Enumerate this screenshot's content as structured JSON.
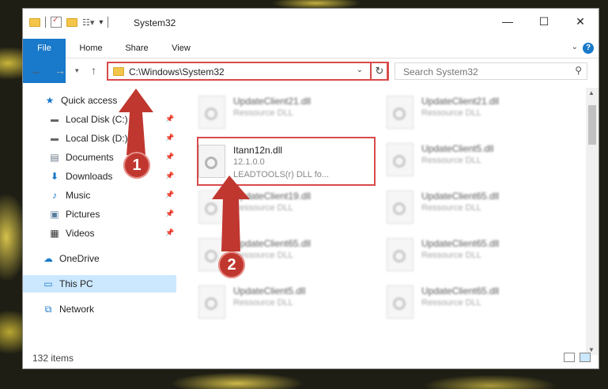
{
  "window": {
    "title": "System32",
    "controls": {
      "minimize": "—",
      "maximize": "☐",
      "close": "✕"
    }
  },
  "ribbon": {
    "tabs": [
      {
        "label": "File"
      },
      {
        "label": "Home"
      },
      {
        "label": "Share"
      },
      {
        "label": "View"
      }
    ],
    "help": "?"
  },
  "nav": {
    "back_icon": "arrow-left-icon",
    "forward_icon": "arrow-right-icon",
    "up_icon": "arrow-up-icon",
    "address": "C:\\Windows\\System32",
    "search_placeholder": "Search System32"
  },
  "sidebar": {
    "items": [
      {
        "label": "Quick access",
        "icon": "star-icon"
      },
      {
        "label": "Local Disk (C:)",
        "icon": "drive-icon"
      },
      {
        "label": "Local Disk (D:)",
        "icon": "drive-icon"
      },
      {
        "label": "Documents",
        "icon": "documents-icon"
      },
      {
        "label": "Downloads",
        "icon": "download-icon"
      },
      {
        "label": "Music",
        "icon": "music-icon"
      },
      {
        "label": "Pictures",
        "icon": "pictures-icon"
      },
      {
        "label": "Videos",
        "icon": "videos-icon"
      },
      {
        "label": "OneDrive",
        "icon": "cloud-icon"
      },
      {
        "label": "This PC",
        "icon": "computer-icon"
      },
      {
        "label": "Network",
        "icon": "network-icon"
      }
    ]
  },
  "files": {
    "left": [
      {
        "name": "UpdateClient21.dll",
        "desc": "Ressource DLL"
      },
      {
        "name": "Itann12n.dll",
        "desc": "12.1.0.0",
        "desc2": "LEADTOOLS(r) DLL fo..."
      },
      {
        "name": "UpdateClient19.dll",
        "desc": "Ressource DLL"
      },
      {
        "name": "UpdateClient65.dll",
        "desc": "Ressource DLL"
      },
      {
        "name": "UpdateClient5.dll",
        "desc": "Ressource DLL"
      }
    ],
    "right": [
      {
        "name": "UpdateClient21.dll",
        "desc": "Ressource DLL"
      },
      {
        "name": "UpdateClient5.dll",
        "desc": "Ressource DLL"
      },
      {
        "name": "UpdateClient65.dll",
        "desc": "Ressource DLL"
      },
      {
        "name": "UpdateClient65.dll",
        "desc": "Ressource DLL"
      },
      {
        "name": "UpdateClient65.dll",
        "desc": "Ressource DLL"
      }
    ]
  },
  "status": {
    "count": "132 items"
  },
  "callouts": {
    "one": "1",
    "two": "2"
  },
  "colors": {
    "accent": "#1979ca",
    "highlight": "#d84b4b",
    "callout": "#c0372f"
  }
}
